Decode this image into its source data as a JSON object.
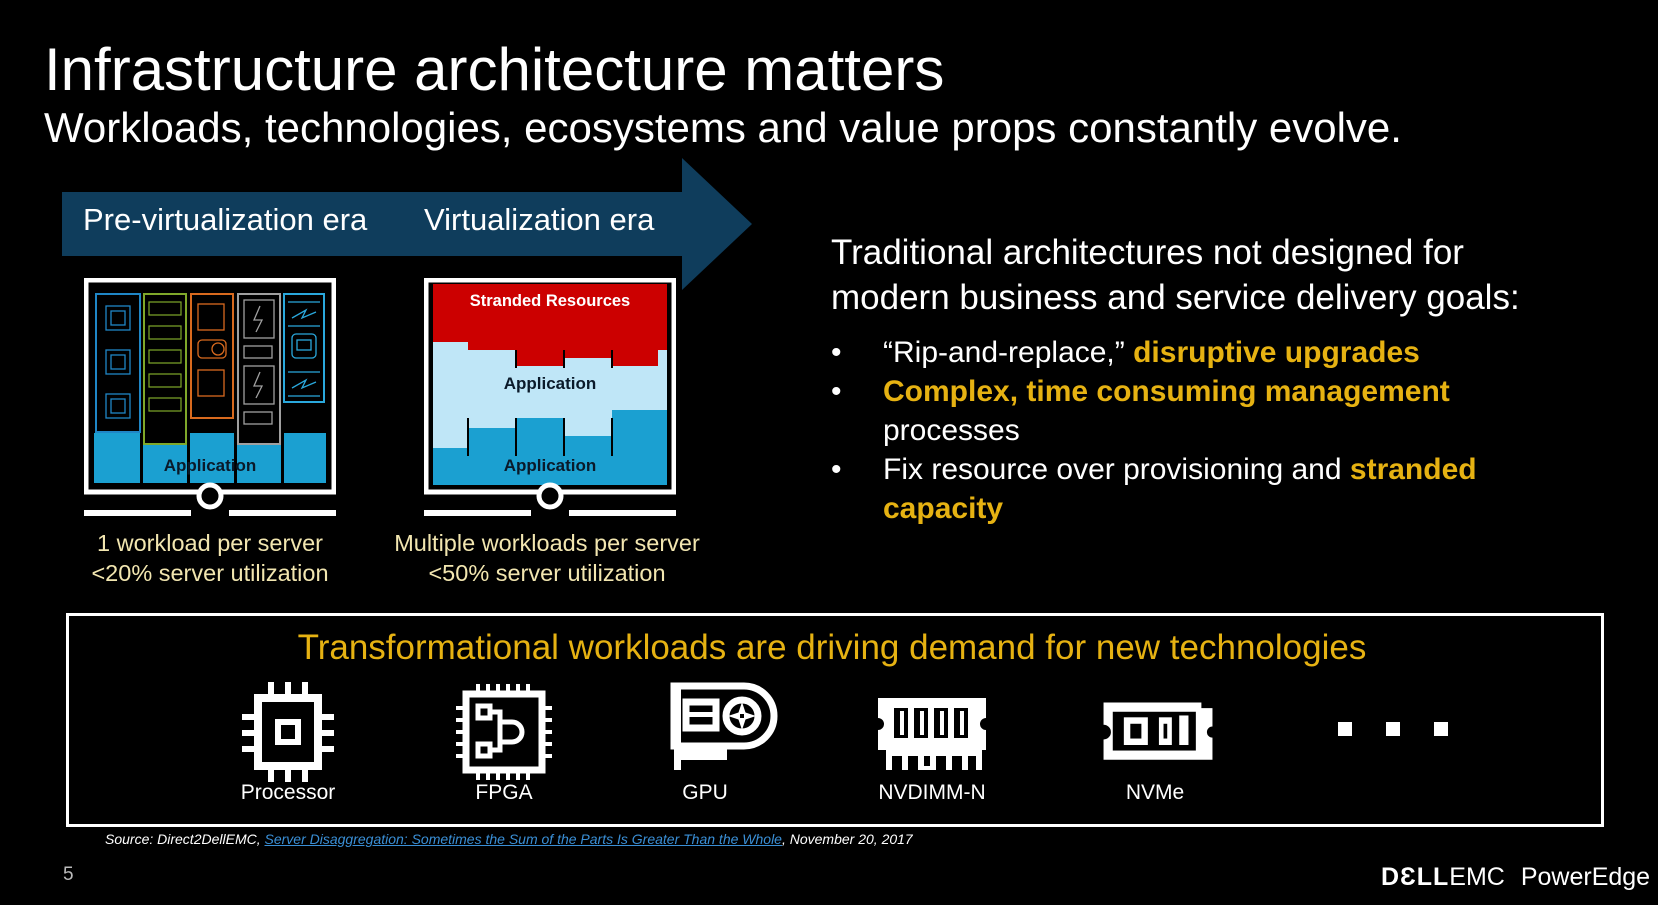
{
  "slide": {
    "title": "Infrastructure architecture matters",
    "subtitle": "Workloads, technologies, ecosystems and value props constantly evolve.",
    "page_number": "5"
  },
  "timeline": {
    "eras": [
      {
        "label": "Pre-virtualization era"
      },
      {
        "label": "Virtualization era"
      }
    ],
    "arrow_color": "#0f3d5c"
  },
  "servers": [
    {
      "name": "pre-virtualization",
      "app_label": "Application",
      "caption_line1": "1 workload per server",
      "caption_line2": "<20% server utilization",
      "columns": [
        {
          "resource": "processor",
          "color": "#1f86c6"
        },
        {
          "resource": "memory",
          "color": "#7fa82a"
        },
        {
          "resource": "fpga-gpu",
          "color": "#d96a1e"
        },
        {
          "resource": "storage",
          "color": "#a0a0a0"
        },
        {
          "resource": "network",
          "color": "#2aa8dc"
        }
      ]
    },
    {
      "name": "virtualization",
      "stranded_label": "Stranded Resources",
      "app_label_upper": "Application",
      "app_label_lower": "Application",
      "caption_line1": "Multiple workloads per server",
      "caption_line2": "<50% server utilization"
    }
  ],
  "right_panel": {
    "heading_line1": "Traditional architectures not designed for",
    "heading_line2": "modern business and service delivery goals:",
    "bullets": [
      {
        "plain_before": "“Rip-and-replace,” ",
        "highlight": "disruptive upgrades",
        "plain_after": ""
      },
      {
        "plain_before": "",
        "highlight": "Complex, time consuming management",
        "continuation": "processes"
      },
      {
        "plain_before": "Fix resource over provisioning and ",
        "highlight": "stranded",
        "continuation_highlight": "capacity"
      }
    ]
  },
  "technologies": {
    "title": "Transformational workloads are driving demand for new technologies",
    "items": [
      {
        "label": "Processor",
        "icon": "processor-icon"
      },
      {
        "label": "FPGA",
        "icon": "fpga-icon"
      },
      {
        "label": "GPU",
        "icon": "gpu-icon"
      },
      {
        "label": "NVDIMM-N",
        "icon": "nvdimm-icon"
      },
      {
        "label": "NVMe",
        "icon": "nvme-icon"
      }
    ],
    "more_indicator": "ellipsis"
  },
  "source": {
    "prefix": "Source:  Direct2DellEMC, ",
    "link_text": "Server Disaggregation:  Sometimes the Sum of the Parts Is Greater Than the Whole",
    "suffix": ", November 20, 2017"
  },
  "brand": {
    "dell": "DƐLL",
    "emc": "EMC",
    "product": "PowerEdge"
  },
  "colors": {
    "highlight": "#e6b212",
    "stranded_red": "#cc0000",
    "app_blue": "#1ba0d1",
    "app_light_blue": "#bfe6f7"
  }
}
